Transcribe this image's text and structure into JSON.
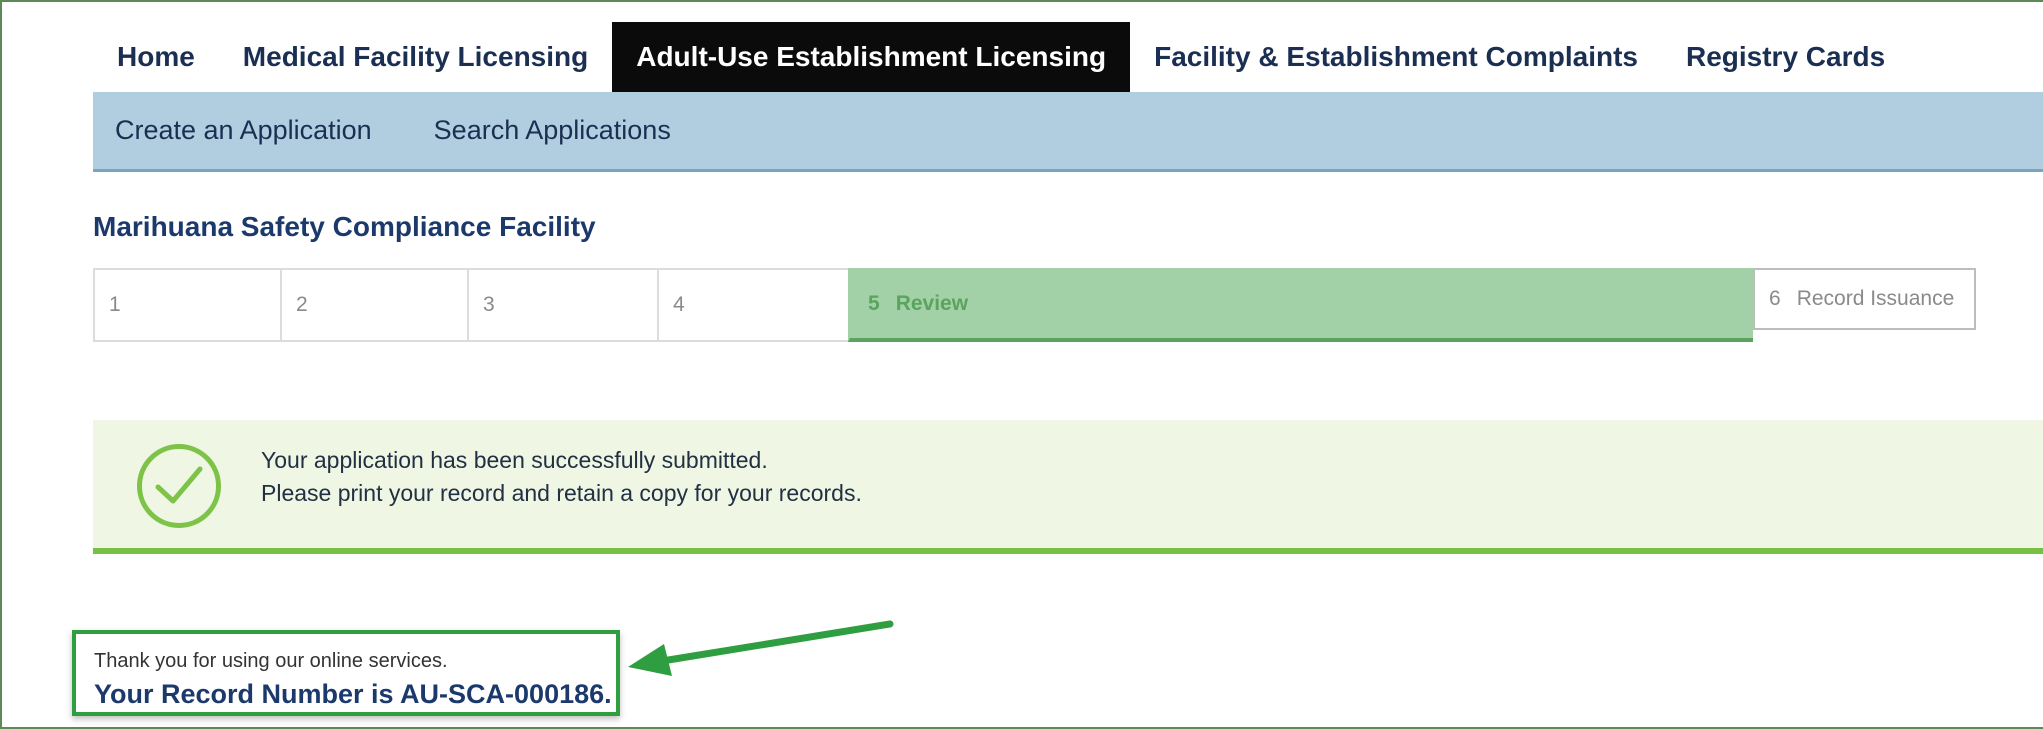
{
  "top_nav": {
    "tabs": [
      {
        "label": "Home"
      },
      {
        "label": "Medical Facility Licensing"
      },
      {
        "label": "Adult-Use Establishment Licensing"
      },
      {
        "label": "Facility & Establishment Complaints"
      },
      {
        "label": "Registry Cards"
      }
    ],
    "active_index": 2
  },
  "sub_nav": {
    "links": [
      {
        "label": "Create an Application"
      },
      {
        "label": "Search Applications"
      }
    ]
  },
  "page": {
    "title": "Marihuana Safety Compliance Facility"
  },
  "steps": [
    {
      "num": "1",
      "label": ""
    },
    {
      "num": "2",
      "label": ""
    },
    {
      "num": "3",
      "label": ""
    },
    {
      "num": "4",
      "label": ""
    },
    {
      "num": "5",
      "label": "Review",
      "current": true
    },
    {
      "num": "6",
      "label": "Record Issuance"
    }
  ],
  "notice": {
    "icon": "check-circle-icon",
    "line1": "Your application has been successfully submitted.",
    "line2": "Please print your record and retain a copy for your records."
  },
  "thanks": {
    "line1": "Thank you for using our online services.",
    "line2": "Your Record Number is AU-SCA-000186."
  },
  "colors": {
    "active_tab": "#0b0b0b",
    "subnav_bg": "#b1cde0",
    "current_step": "#a3d1a7",
    "success_accent": "#76c043",
    "callout_border": "#2f9e41"
  }
}
